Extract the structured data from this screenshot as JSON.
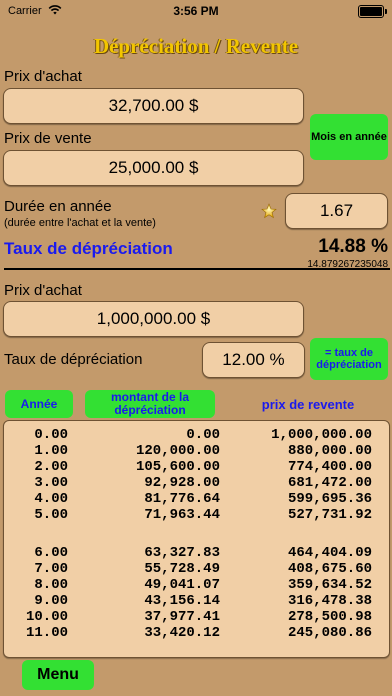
{
  "status_bar": {
    "carrier": "Carrier",
    "time": "3:56 PM",
    "wifi_icon": "wifi-icon",
    "battery_icon": "battery-icon"
  },
  "title": "Dépréciation / Revente",
  "section1": {
    "purchase_label": "Prix d'achat",
    "purchase_value": "32,700.00 $",
    "sale_label": "Prix de vente",
    "sale_value": "25,000.00 $",
    "months_button": "Mois en année",
    "duration_label": "Durée en année",
    "duration_sub": "(durée entre l'achat et la vente)",
    "duration_value": "1.67",
    "rate_label": "Taux de dépréciation",
    "rate_value": "14.88 %",
    "rate_precise": "14.879267235048"
  },
  "section2": {
    "purchase_label": "Prix d'achat",
    "purchase_value": "1,000,000.00 $",
    "rate_label": "Taux de dépréciation",
    "rate_value": "12.00 %",
    "rate_button": "= taux de dépréciation"
  },
  "table": {
    "col_year_button": "Année",
    "col_amount_button": "montant de la dépréciation",
    "col_resale_label": "prix de revente",
    "rows_a": [
      [
        "0.00",
        "0.00",
        "1,000,000.00"
      ],
      [
        "1.00",
        "120,000.00",
        "880,000.00"
      ],
      [
        "2.00",
        "105,600.00",
        "774,400.00"
      ],
      [
        "3.00",
        "92,928.00",
        "681,472.00"
      ],
      [
        "4.00",
        "81,776.64",
        "599,695.36"
      ],
      [
        "5.00",
        "71,963.44",
        "527,731.92"
      ]
    ],
    "rows_b": [
      [
        "6.00",
        "63,327.83",
        "464,404.09"
      ],
      [
        "7.00",
        "55,728.49",
        "408,675.60"
      ],
      [
        "8.00",
        "49,041.07",
        "359,634.52"
      ],
      [
        "9.00",
        "43,156.14",
        "316,478.38"
      ],
      [
        "10.00",
        "37,977.41",
        "278,500.98"
      ],
      [
        "11.00",
        "33,420.12",
        "245,080.86"
      ]
    ]
  },
  "menu_button": "Menu",
  "colors": {
    "background": "#c39a6b",
    "field": "#f1cfa6",
    "green": "#33e033",
    "blue": "#1a1aee",
    "title": "#f3c600"
  }
}
